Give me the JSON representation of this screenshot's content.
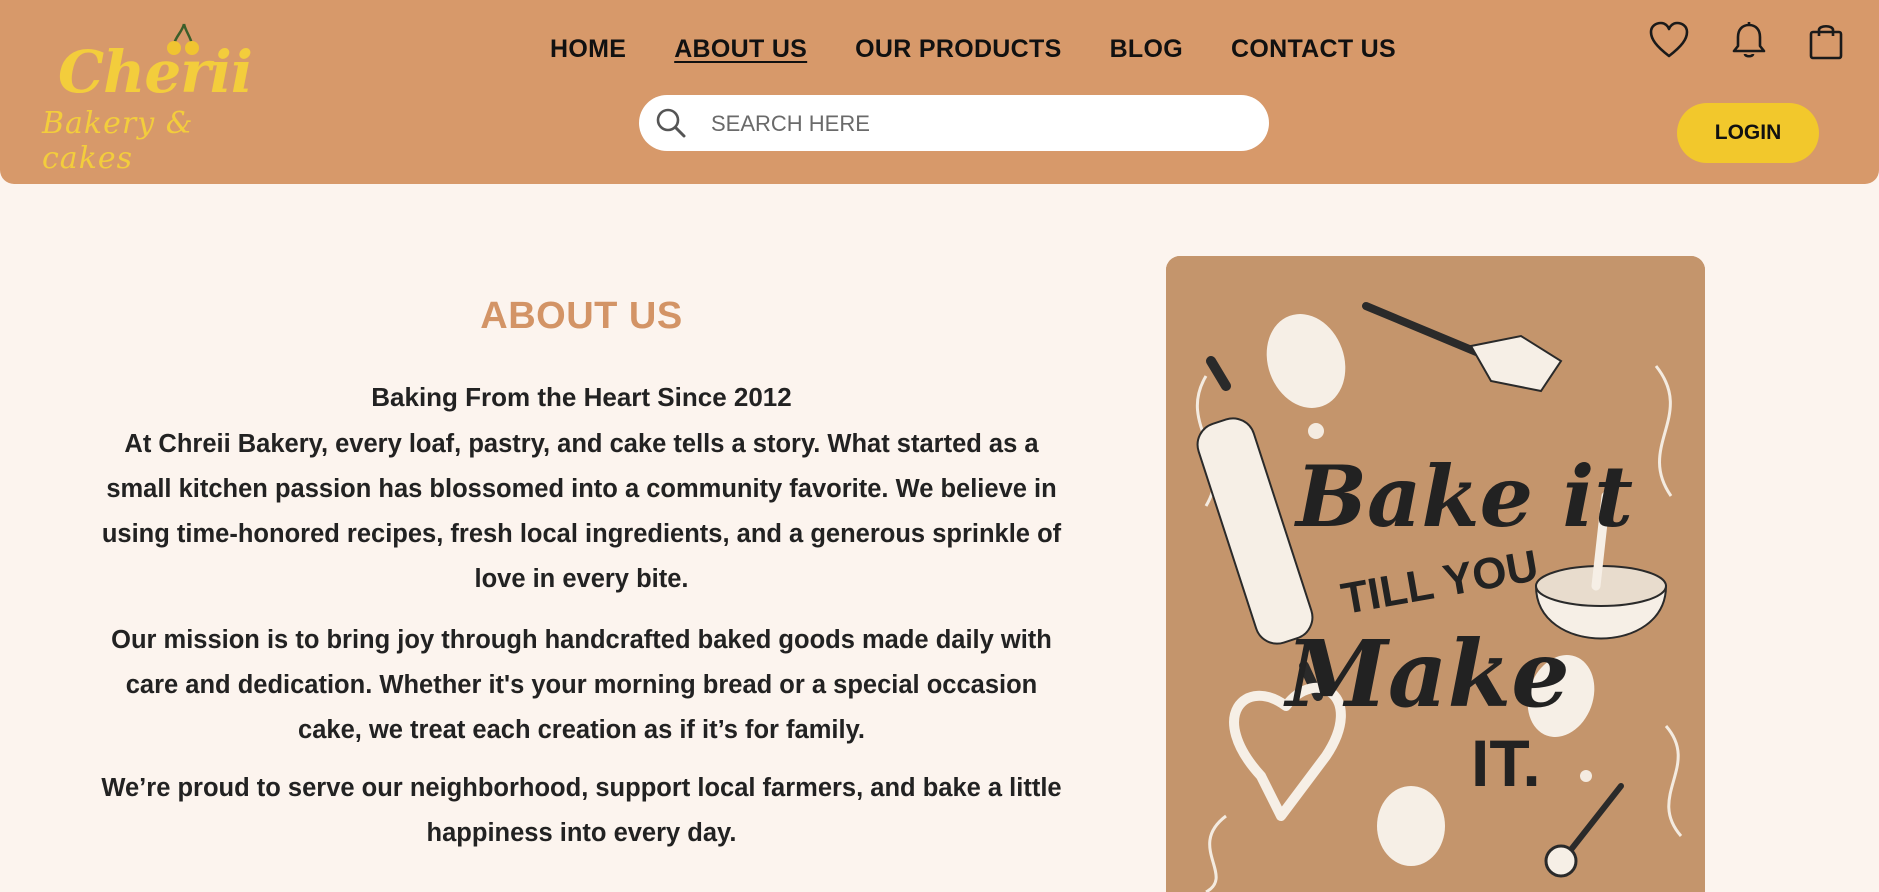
{
  "header": {
    "logo": {
      "brand": "Cherii",
      "tagline": "Bakery & cakes"
    },
    "nav": [
      {
        "label": "HOME",
        "active": false
      },
      {
        "label": "ABOUT US",
        "active": true
      },
      {
        "label": "OUR PRODUCTS",
        "active": false
      },
      {
        "label": "BLOG",
        "active": false
      },
      {
        "label": "CONTACT US",
        "active": false
      }
    ],
    "search": {
      "placeholder": "SEARCH HERE",
      "value": "",
      "icon": "search-icon"
    },
    "icons": [
      "heart-icon",
      "bell-icon",
      "shopping-bag-icon"
    ],
    "login_label": "LOGIN"
  },
  "about": {
    "title": "ABOUT US",
    "subheading": "Baking From the Heart Since 2012",
    "paragraphs": [
      "At Chreii Bakery, every loaf, pastry, and cake tells a story. What started as a small kitchen passion has blossomed into a community favorite. We believe in using time-honored recipes, fresh local ingredients, and a generous sprinkle of love in every bite.",
      "Our mission is to bring joy through handcrafted baked goods made daily with care and dedication. Whether it's your morning bread or a special occasion cake, we treat each creation as if it’s for family.",
      "We’re proud to serve our neighborhood, support local farmers, and bake a little happiness into every day."
    ]
  },
  "poster": {
    "lines": [
      "Bake it",
      "TILL YOU",
      "Make",
      "IT."
    ]
  },
  "colors": {
    "header_bg": "#d7996a",
    "page_bg": "#fcf4ee",
    "accent_yellow": "#f2c82c",
    "title_color": "#d39466"
  }
}
